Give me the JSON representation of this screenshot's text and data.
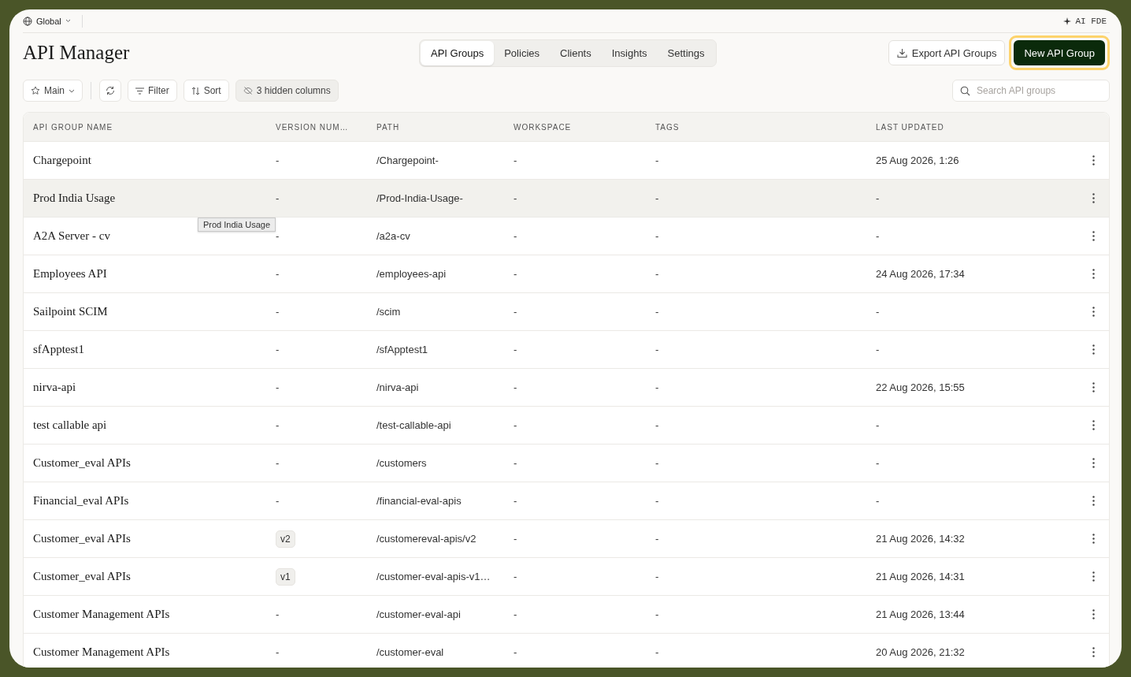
{
  "topbar": {
    "scope": "Global",
    "assistant": "AI FDE"
  },
  "title": "API Manager",
  "tabs": [
    {
      "label": "API Groups",
      "selected": true
    },
    {
      "label": "Policies",
      "selected": false
    },
    {
      "label": "Clients",
      "selected": false
    },
    {
      "label": "Insights",
      "selected": false
    },
    {
      "label": "Settings",
      "selected": false
    }
  ],
  "actions": {
    "export": "Export API Groups",
    "create": "New API Group",
    "create_focused": true
  },
  "toolbar": {
    "view": "Main",
    "filter": "Filter",
    "sort": "Sort",
    "hidden_columns": "3 hidden columns",
    "search": {
      "placeholder": "Search API groups"
    }
  },
  "table": {
    "columns": [
      "API GROUP NAME",
      "VERSION NUM…",
      "PATH",
      "WORKSPACE",
      "TAGS",
      "LAST UPDATED"
    ],
    "rows": [
      {
        "name": "Chargepoint",
        "version": {
          "kind": "text",
          "text": "-"
        },
        "path": "/Chargepoint-",
        "workspace": "-",
        "tags": "-",
        "updated": "25 Aug 2026, 1:26",
        "hovered": false
      },
      {
        "name": "Prod India Usage",
        "version": {
          "kind": "text",
          "text": "-"
        },
        "path": "/Prod-India-Usage-",
        "workspace": "-",
        "tags": "-",
        "updated": "-",
        "hovered": true
      },
      {
        "name": "A2A Server - cv",
        "version": {
          "kind": "text",
          "text": "-"
        },
        "path": "/a2a-cv",
        "workspace": "-",
        "tags": "-",
        "updated": "-",
        "hovered": false
      },
      {
        "name": "Employees API",
        "version": {
          "kind": "text",
          "text": "-"
        },
        "path": "/employees-api",
        "workspace": "-",
        "tags": "-",
        "updated": "24 Aug 2026, 17:34",
        "hovered": false
      },
      {
        "name": "Sailpoint SCIM",
        "version": {
          "kind": "text",
          "text": "-"
        },
        "path": "/scim",
        "workspace": "-",
        "tags": "-",
        "updated": "-",
        "hovered": false
      },
      {
        "name": "sfApptest1",
        "version": {
          "kind": "text",
          "text": "-"
        },
        "path": "/sfApptest1",
        "workspace": "-",
        "tags": "-",
        "updated": "-",
        "hovered": false
      },
      {
        "name": "nirva-api",
        "version": {
          "kind": "text",
          "text": "-"
        },
        "path": "/nirva-api",
        "workspace": "-",
        "tags": "-",
        "updated": "22 Aug 2026, 15:55",
        "hovered": false
      },
      {
        "name": "test callable api",
        "version": {
          "kind": "text",
          "text": "-"
        },
        "path": "/test-callable-api",
        "workspace": "-",
        "tags": "-",
        "updated": "-",
        "hovered": false
      },
      {
        "name": "Customer_eval APIs",
        "version": {
          "kind": "text",
          "text": "-"
        },
        "path": "/customers",
        "workspace": "-",
        "tags": "-",
        "updated": "-",
        "hovered": false
      },
      {
        "name": "Financial_eval APIs",
        "version": {
          "kind": "text",
          "text": "-"
        },
        "path": "/financial-eval-apis",
        "workspace": "-",
        "tags": "-",
        "updated": "-",
        "hovered": false
      },
      {
        "name": "Customer_eval APIs",
        "version": {
          "kind": "badge",
          "text": "v2"
        },
        "path": "/customereval-apis/v2",
        "workspace": "-",
        "tags": "-",
        "updated": "21 Aug 2026, 14:32",
        "hovered": false
      },
      {
        "name": "Customer_eval APIs",
        "version": {
          "kind": "badge",
          "text": "v1"
        },
        "path": "/customer-eval-apis-v1…",
        "workspace": "-",
        "tags": "-",
        "updated": "21 Aug 2026, 14:31",
        "hovered": false
      },
      {
        "name": "Customer Management APIs",
        "version": {
          "kind": "text",
          "text": "-"
        },
        "path": "/customer-eval-api",
        "workspace": "-",
        "tags": "-",
        "updated": "21 Aug 2026, 13:44",
        "hovered": false
      },
      {
        "name": "Customer Management APIs",
        "version": {
          "kind": "text",
          "text": "-"
        },
        "path": "/customer-eval",
        "workspace": "-",
        "tags": "-",
        "updated": "20 Aug 2026, 21:32",
        "hovered": false
      }
    ]
  },
  "tooltip": {
    "text": "Prod India Usage"
  }
}
